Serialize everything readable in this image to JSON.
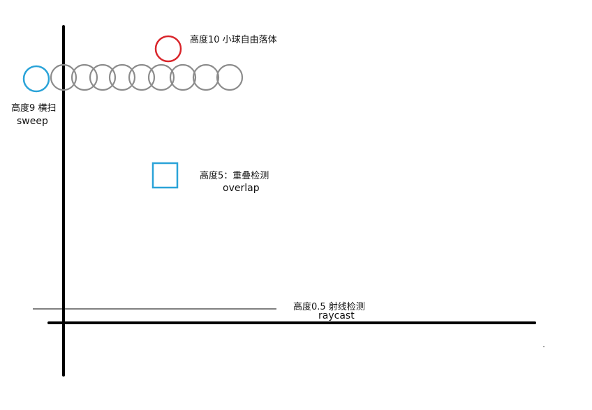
{
  "annotations": {
    "free_fall": "高度10 小球自由落体",
    "sweep_cn": "高度9 横扫",
    "sweep_en": "sweep",
    "overlap_cn": "高度5：重叠检测",
    "overlap_en": "overlap",
    "raycast_cn": "高度0.5 射线检测",
    "raycast_en": "raycast"
  },
  "colors": {
    "axis": "#000000",
    "sweep_start": "#2aa3d8",
    "sweep_trail": "#8c8c8c",
    "free_fall_ball": "#d9252b",
    "overlap_box": "#2aa3d8",
    "ray": "#000000"
  }
}
